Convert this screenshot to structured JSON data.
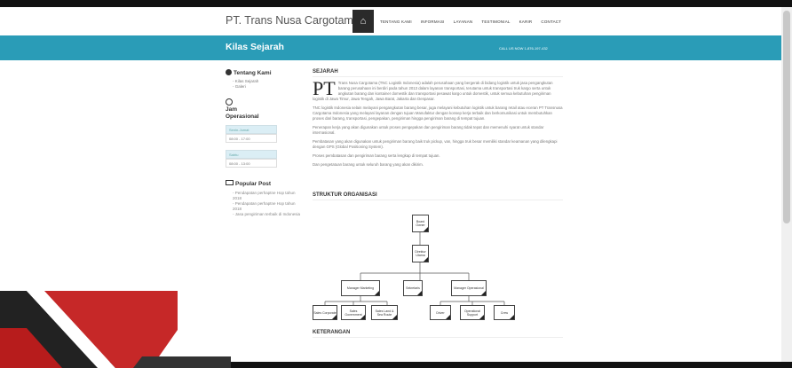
{
  "brand": "PT. Trans Nusa Cargotama",
  "nav": [
    "TENTANG KAMI",
    "INFORMASI",
    "LAYANAN",
    "TESTIMONIAL",
    "KARIR",
    "CONTACT"
  ],
  "band": {
    "title": "Kilas Sejarah",
    "phone": "CALL US NOW 1-876-197-432"
  },
  "sidebar": {
    "about_title": "Tentang Kami",
    "about_items": [
      "Kilas Sejarah",
      "Galeri"
    ],
    "hours_title": "Jam Operasional",
    "hours": [
      {
        "label": "Senin-Jumat",
        "value": "08:00 - 17:00"
      },
      {
        "label": "Sabtu",
        "value": "08:00 - 13:00"
      }
    ],
    "popular_title": "Popular Post",
    "popular": [
      "Pendapatan perhaptne Hop tahun 2018",
      "Pendapatan perhaptne Hop tahun 2018",
      "Jasa pengiriman terbaik di Indonesia"
    ]
  },
  "main": {
    "section1": "SEJARAH",
    "dropcap": "PT",
    "para1": "Trans Nusa Cargotama (TNC Logistik Indonesia) adalah perusahaan yang bergerak di bidang logistik untuk jasa pengangkutan barang perusahaan ini berdiri pada tahun 2013 dalam layanan transportasi, terutama untuk transportasi truk kargo serta untuk angkutan barang dan kontainer domestik dan transportasi pesawat kargo untuk domestik, untuk semua kebutuhan pengiriman logistik di Jawa Timur, Jawa Tengah, Jawa Barat, Jakarta dan Denpasar.",
    "para2": "TNC logistik Indonesia selain melayani pengangkutan barang besar, juga melayani kebutuhan logistik untuk barang retail atau eceran PT Transnusa Cargotama Indonesia yang melayani layanan dengan tujuan Manufaktur dengan konsep kerja terbaik dan berkomunikasi untuk membutuhkan proses dari barang, transportasi, pengepakan, pengiriman hingga pengiriman barang di tempat tujuan.",
    "para3": "Penerapan kerja yang akan digunakan untuk proses pengepakan dan pengiriman barang tidak tepat dan memenuhi syarat untuk standar internasional.",
    "para4": "Pembatasan yang akan digunakan untuk pengiriman barang baik truk pickup, van, hingga truk besar memiliki standar keamanan yang dilengkapi dengan GPS (Global Positioning System).",
    "para5": "Proses pembatasan dan pengiriman barang serta lengkap di tempat tujuan.",
    "para6": "Dan pengetatuan barang untuk seluruh barang yang akan dikirim.",
    "section2": "STRUKTUR ORGANISASI",
    "section3": "KETERANGAN",
    "org": {
      "board": "Board Owner",
      "director": "Direktur Utama",
      "staff": "Sekretaris",
      "marketing": "Manager Marketing",
      "operational": "Manager Operasional",
      "sales1": "Sales Corporate",
      "sales2": "Sales Government",
      "sales3": "Sales Land & Sea Route",
      "ops1": "Driver",
      "ops2": "Operational Support",
      "ops3": "Crew"
    }
  }
}
